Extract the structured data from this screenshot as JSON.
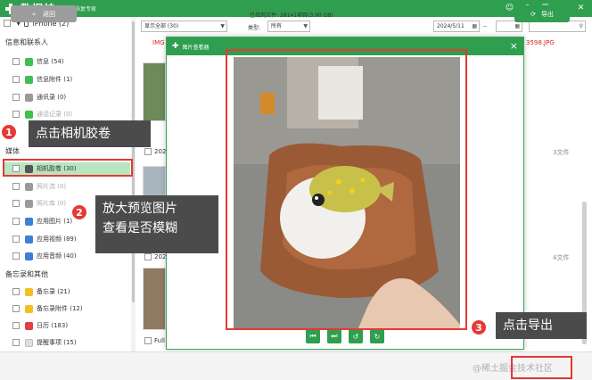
{
  "app": {
    "name": "数据蛙",
    "slogan": "苹果恢复专家"
  },
  "sidebar": {
    "device": "iPhone (2)",
    "sections": [
      {
        "title": "信息和联系人",
        "items": [
          {
            "label": "信息 (54)",
            "color": "#3fbf4f"
          },
          {
            "label": "信息附件 (1)",
            "color": "#3fbf4f"
          },
          {
            "label": "通讯录 (0)",
            "color": "#999999",
            "dim": false
          },
          {
            "label": "通话记录 (0)",
            "color": "#3fbf4f",
            "dim": true
          }
        ]
      },
      {
        "title": "媒体",
        "items": [
          {
            "label": "相机胶卷 (30)",
            "color": "#555555",
            "selected": true
          },
          {
            "label": "照片流 (0)",
            "color": "#9a9a9a",
            "dim": true
          },
          {
            "label": "照片库 (0)",
            "color": "#9a9a9a",
            "dim": true
          },
          {
            "label": "应用图片 (1)",
            "color": "#3d7fd6"
          },
          {
            "label": "应用视频 (89)",
            "color": "#3d7fd6"
          },
          {
            "label": "应用音频 (40)",
            "color": "#3d7fd6"
          }
        ]
      },
      {
        "title": "备忘录和其他",
        "items": [
          {
            "label": "备忘录 (21)",
            "color": "#f0c020"
          },
          {
            "label": "备忘录附件 (12)",
            "color": "#f0c020"
          },
          {
            "label": "日历 (183)",
            "color": "#e04040"
          },
          {
            "label": "提醒事项 (15)",
            "color": "#e0e0e0"
          }
        ]
      }
    ]
  },
  "toolbar": {
    "display_select": "显示全部 (30)",
    "type_label": "类型:",
    "type_select": "所有",
    "date_select": "2024/5/11",
    "date_sep": "--"
  },
  "content": {
    "left_img_label": "IMG",
    "right_img_label": "3598.JPG",
    "count_a": "3文件",
    "count_b": "4文件",
    "thumb_caption_a": "202",
    "thumb_caption_b": "202",
    "thumb_caption_c": "Full"
  },
  "viewer": {
    "title": "图片查看器",
    "close": "×",
    "controls": [
      "⏮",
      "⏭",
      "↺",
      "↻"
    ]
  },
  "annotations": {
    "step1_num": "1",
    "step1_text": "点击相机胶卷",
    "step2_num": "2",
    "step2_text_line1": "放大预览图片",
    "step2_text_line2": "查看是否模糊",
    "step3_num": "3",
    "step3_text": "点击导出"
  },
  "footer": {
    "back_label": "返回",
    "scan_info": "已找到文件: 28141项目(3.90 GB)",
    "export_label": "导出",
    "watermark": "@稀土掘金技术社区"
  },
  "colors": {
    "brand": "#2f9e4f",
    "highlight": "#e53935"
  }
}
